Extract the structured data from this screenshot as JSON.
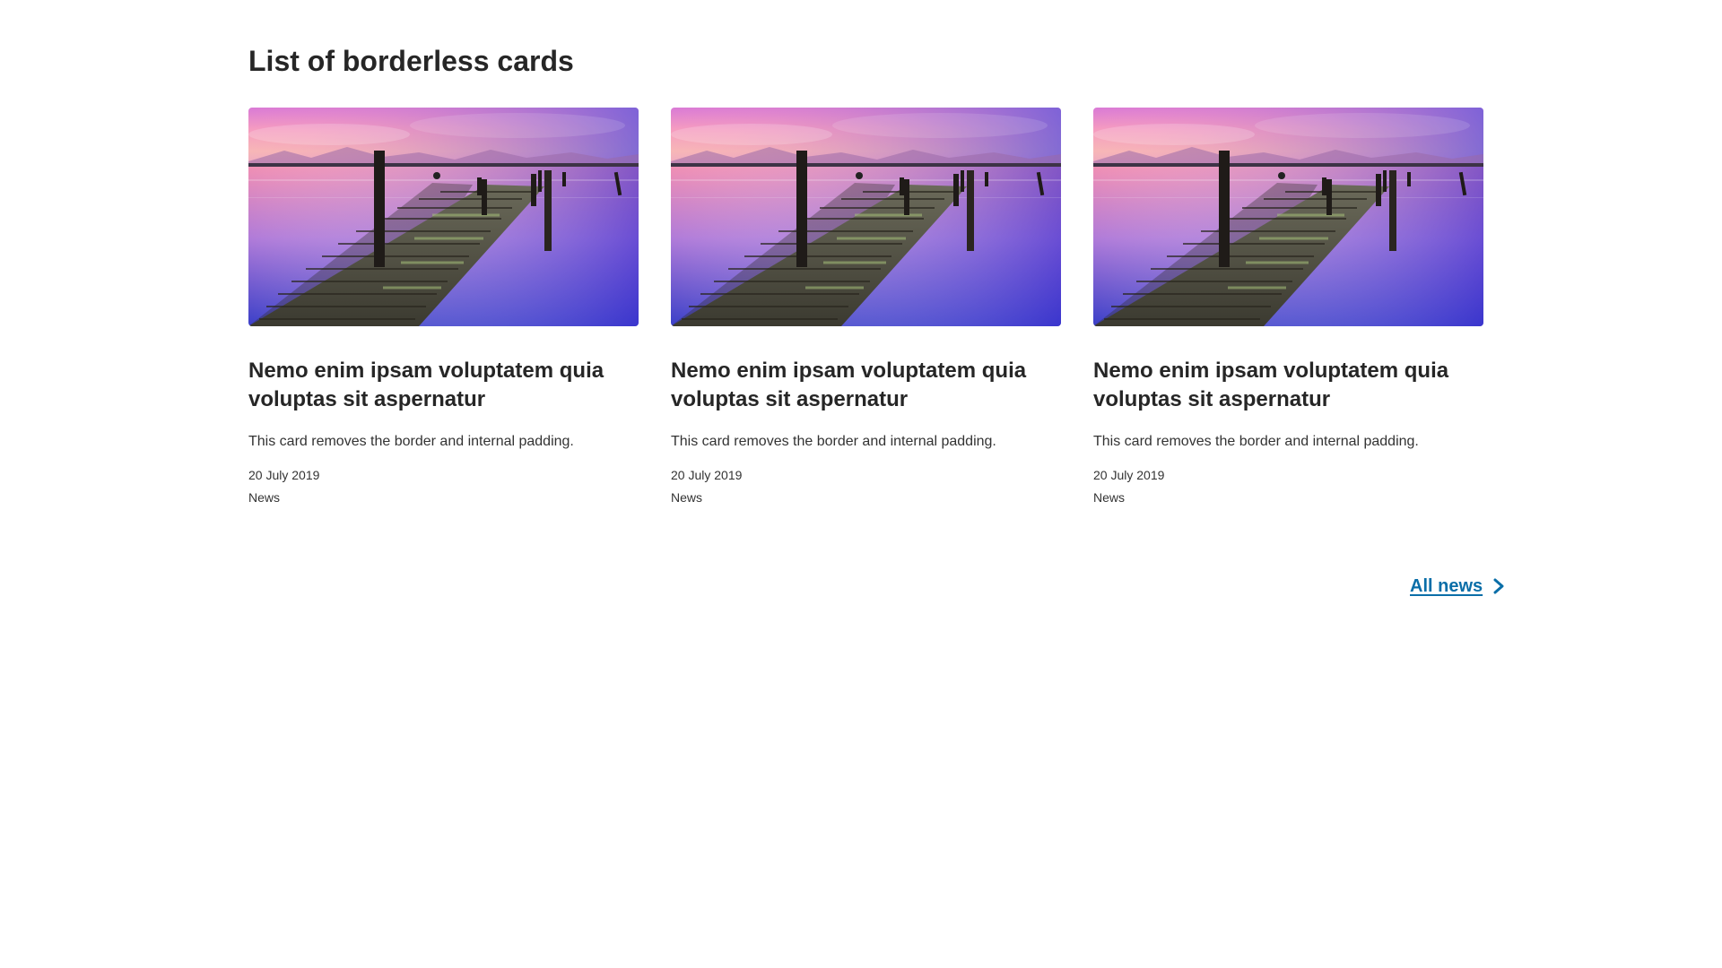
{
  "section": {
    "title": "List of borderless cards"
  },
  "cards": [
    {
      "title": "Nemo enim ipsam voluptatem quia voluptas sit aspernatur",
      "description": "This card removes the border and internal padding.",
      "date": "20 July 2019",
      "category": "News",
      "image": "pier-at-sunset-photo"
    },
    {
      "title": "Nemo enim ipsam voluptatem quia voluptas sit aspernatur",
      "description": "This card removes the border and internal padding.",
      "date": "20 July 2019",
      "category": "News",
      "image": "pier-at-sunset-photo"
    },
    {
      "title": "Nemo enim ipsam voluptatem quia voluptas sit aspernatur",
      "description": "This card removes the border and internal padding.",
      "date": "20 July 2019",
      "category": "News",
      "image": "pier-at-sunset-photo"
    }
  ],
  "footer_link": {
    "label": "All news",
    "icon": "chevron-right-icon"
  },
  "colors": {
    "text": "#262626",
    "link": "#0a6ea8",
    "background": "#ffffff"
  }
}
